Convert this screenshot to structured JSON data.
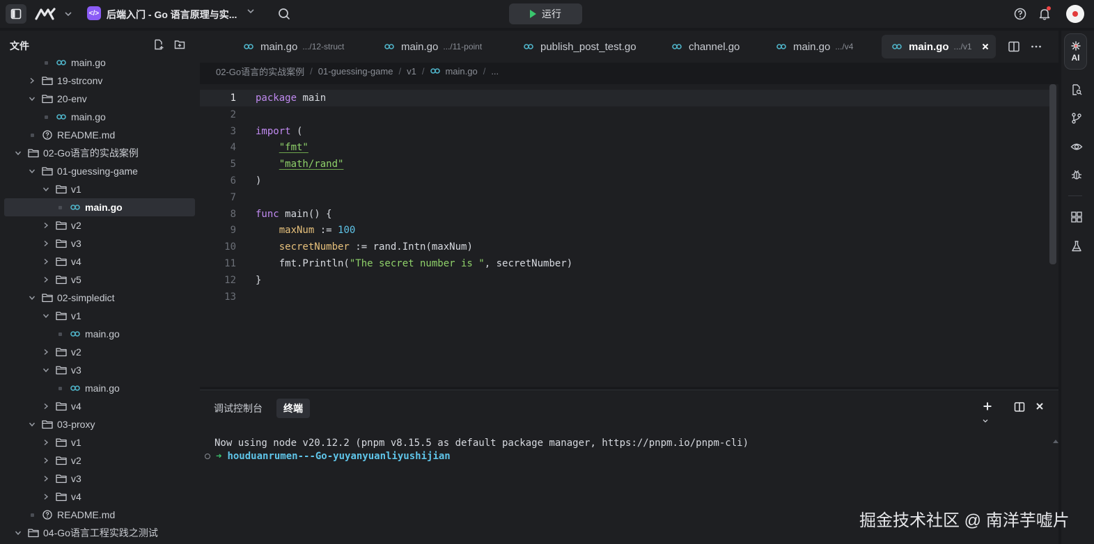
{
  "topbar": {
    "project_title": "后端入门 - Go 语言原理与实...",
    "run_label": "运行"
  },
  "sidebar": {
    "title": "文件",
    "tree": [
      {
        "label": "main.go",
        "type": "file",
        "depth": 3
      },
      {
        "label": "19-strconv",
        "type": "folder",
        "depth": 2,
        "expanded": false
      },
      {
        "label": "20-env",
        "type": "folder",
        "depth": 2,
        "expanded": true
      },
      {
        "label": "main.go",
        "type": "file",
        "depth": 3
      },
      {
        "label": "README.md",
        "type": "readme",
        "depth": 2
      },
      {
        "label": "02-Go语言的实战案例",
        "type": "folder",
        "depth": 1,
        "expanded": true
      },
      {
        "label": "01-guessing-game",
        "type": "folder",
        "depth": 2,
        "expanded": true
      },
      {
        "label": "v1",
        "type": "folder",
        "depth": 3,
        "expanded": true
      },
      {
        "label": "main.go",
        "type": "file",
        "depth": 4,
        "selected": true
      },
      {
        "label": "v2",
        "type": "folder",
        "depth": 3,
        "expanded": false
      },
      {
        "label": "v3",
        "type": "folder",
        "depth": 3,
        "expanded": false
      },
      {
        "label": "v4",
        "type": "folder",
        "depth": 3,
        "expanded": false
      },
      {
        "label": "v5",
        "type": "folder",
        "depth": 3,
        "expanded": false
      },
      {
        "label": "02-simpledict",
        "type": "folder",
        "depth": 2,
        "expanded": true
      },
      {
        "label": "v1",
        "type": "folder",
        "depth": 3,
        "expanded": true
      },
      {
        "label": "main.go",
        "type": "file",
        "depth": 4
      },
      {
        "label": "v2",
        "type": "folder",
        "depth": 3,
        "expanded": false
      },
      {
        "label": "v3",
        "type": "folder",
        "depth": 3,
        "expanded": true
      },
      {
        "label": "main.go",
        "type": "file",
        "depth": 4
      },
      {
        "label": "v4",
        "type": "folder",
        "depth": 3,
        "expanded": false
      },
      {
        "label": "03-proxy",
        "type": "folder",
        "depth": 2,
        "expanded": true
      },
      {
        "label": "v1",
        "type": "folder",
        "depth": 3,
        "expanded": false
      },
      {
        "label": "v2",
        "type": "folder",
        "depth": 3,
        "expanded": false
      },
      {
        "label": "v3",
        "type": "folder",
        "depth": 3,
        "expanded": false
      },
      {
        "label": "v4",
        "type": "folder",
        "depth": 3,
        "expanded": false
      },
      {
        "label": "README.md",
        "type": "readme",
        "depth": 2
      },
      {
        "label": "04-Go语言工程实践之测试",
        "type": "folder",
        "depth": 1,
        "expanded": true
      }
    ]
  },
  "tabs": [
    {
      "name": "main.go",
      "path": ".../12-struct",
      "active": false
    },
    {
      "name": "main.go",
      "path": ".../11-point",
      "active": false
    },
    {
      "name": "publish_post_test.go",
      "path": "",
      "active": false
    },
    {
      "name": "channel.go",
      "path": "",
      "active": false
    },
    {
      "name": "main.go",
      "path": ".../v4",
      "active": false
    },
    {
      "name": "main.go",
      "path": ".../v1",
      "active": true
    }
  ],
  "breadcrumb": [
    "02-Go语言的实战案例",
    "01-guessing-game",
    "v1",
    "main.go",
    "..."
  ],
  "editor": {
    "current_line": 1,
    "lines": [
      [
        {
          "t": "package",
          "c": "kw"
        },
        {
          "t": " main",
          "c": ""
        }
      ],
      [],
      [
        {
          "t": "import",
          "c": "kw"
        },
        {
          "t": " (",
          "c": ""
        }
      ],
      [
        {
          "t": "    ",
          "c": ""
        },
        {
          "t": "\"fmt\"",
          "c": "str"
        }
      ],
      [
        {
          "t": "    ",
          "c": ""
        },
        {
          "t": "\"math/rand\"",
          "c": "str"
        }
      ],
      [
        {
          "t": ")",
          "c": ""
        }
      ],
      [],
      [
        {
          "t": "func",
          "c": "kw"
        },
        {
          "t": " main() {",
          "c": ""
        }
      ],
      [
        {
          "t": "    ",
          "c": ""
        },
        {
          "t": "maxNum",
          "c": "var"
        },
        {
          "t": " := ",
          "c": ""
        },
        {
          "t": "100",
          "c": "num"
        }
      ],
      [
        {
          "t": "    ",
          "c": ""
        },
        {
          "t": "secretNumber",
          "c": "var"
        },
        {
          "t": " := rand.Intn(maxNum)",
          "c": ""
        }
      ],
      [
        {
          "t": "    fmt.Println(",
          "c": ""
        },
        {
          "t": "\"The secret number is \"",
          "c": "plain-str"
        },
        {
          "t": ", secretNumber)",
          "c": ""
        }
      ],
      [
        {
          "t": "}",
          "c": ""
        }
      ],
      []
    ]
  },
  "panel": {
    "tabs": [
      {
        "label": "调试控制台",
        "active": false
      },
      {
        "label": "终端",
        "active": true
      }
    ],
    "terminal": {
      "output": "Now using node v20.12.2 (pnpm v8.15.5 as default package manager, https://pnpm.io/pnpm-cli)",
      "prompt_arrow": "➜",
      "prompt_dir": "houduanrumen---Go-yuyanyuanliyushijian"
    }
  },
  "activity_bar": {
    "ai_label": "AI"
  },
  "watermark": "掘金技术社区 @ 南洋芋嘘片",
  "colors": {
    "background": "#18191c",
    "panel": "#1e1f22",
    "keyword": "#c08af0",
    "string": "#8fd16a",
    "number": "#5fc4e8",
    "go_icon": "#4fb3c8",
    "run_green": "#3ac66e",
    "project_icon": "#8b5cf6"
  }
}
